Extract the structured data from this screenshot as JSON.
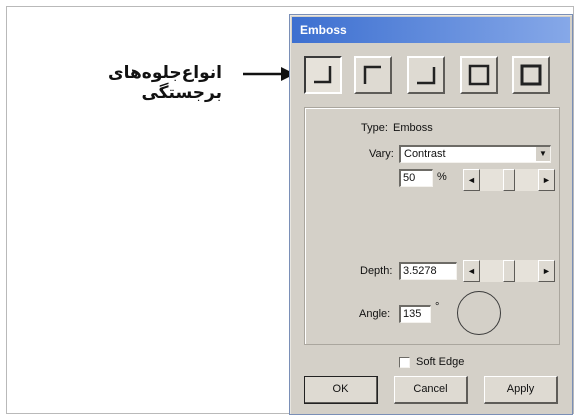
{
  "annotation": {
    "text": "انواع‌جلوه‌های برجستگی"
  },
  "dialog": {
    "title": "Emboss",
    "type_label": "Type:",
    "type_value": "Emboss",
    "vary_label": "Vary:",
    "vary_value": "Contrast",
    "vary_amount": "50",
    "vary_unit": "%",
    "depth_label": "Depth:",
    "depth_value": "3.5278",
    "angle_label": "Angle:",
    "angle_value": "135",
    "angle_unit": "°",
    "soft_edge_label": "Soft Edge",
    "soft_edge_checked": false,
    "ok_label": "OK",
    "cancel_label": "Cancel",
    "apply_label": "Apply"
  },
  "icons": {
    "left_arrow": "◄",
    "right_arrow": "►",
    "dropdown_arrow": "▼"
  }
}
